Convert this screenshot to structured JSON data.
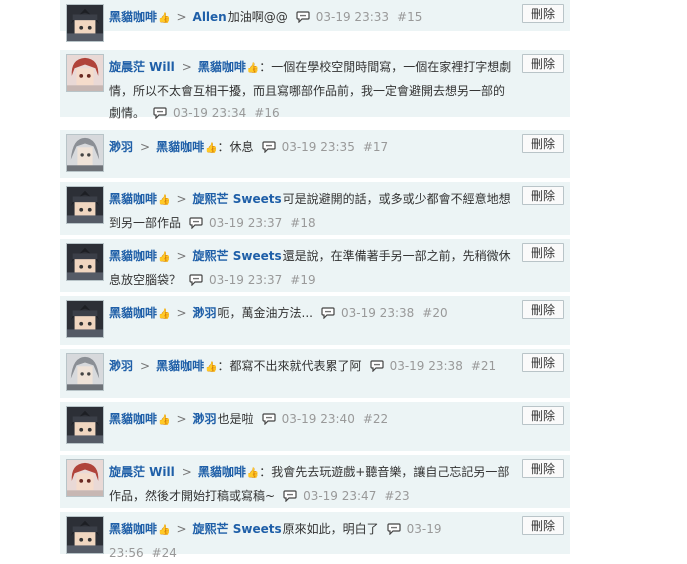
{
  "delete_label": "刪除",
  "comments": [
    {
      "from": "黑貓咖啡",
      "from_badge": "👍",
      "to": "Allen",
      "to_badge": "",
      "text": "加油啊@@",
      "time": "03-19 23:33",
      "floor": "#15",
      "avatar": "dark"
    },
    {
      "from": "旋晨茫 Will",
      "from_badge": "",
      "to": "黑貓咖啡",
      "to_badge": "👍",
      "text": "：一個在學校空閒時間寫，一個在家裡打字想劇情，所以不太會互相干擾，而且寫哪部作品前，我一定會避開去想另一部的劇情。",
      "time": "03-19 23:34",
      "floor": "#16",
      "avatar": "red"
    },
    {
      "from": "渺羽",
      "from_badge": "",
      "to": "黑貓咖啡",
      "to_badge": "👍",
      "text": "：休息",
      "time": "03-19 23:35",
      "floor": "#17",
      "avatar": "grey"
    },
    {
      "from": "黑貓咖啡",
      "from_badge": "👍",
      "to": "旋熙芒 Sweets",
      "to_badge": "",
      "text": "可是說避開的話，或多或少都會不經意地想到另一部作品",
      "time": "03-19 23:37",
      "floor": "#18",
      "avatar": "dark"
    },
    {
      "from": "黑貓咖啡",
      "from_badge": "👍",
      "to": "旋熙芒 Sweets",
      "to_badge": "",
      "text": "還是說，在準備著手另一部之前，先稍微休息放空腦袋？",
      "time": "03-19 23:37",
      "floor": "#19",
      "avatar": "dark"
    },
    {
      "from": "黑貓咖啡",
      "from_badge": "👍",
      "to": "渺羽",
      "to_badge": "",
      "text": "呃，萬金油方法...",
      "time": "03-19 23:38",
      "floor": "#20",
      "avatar": "dark"
    },
    {
      "from": "渺羽",
      "from_badge": "",
      "to": "黑貓咖啡",
      "to_badge": "👍",
      "text": "：都寫不出來就代表累了阿",
      "time": "03-19 23:38",
      "floor": "#21",
      "avatar": "grey"
    },
    {
      "from": "黑貓咖啡",
      "from_badge": "👍",
      "to": "渺羽",
      "to_badge": "",
      "text": "也是啦",
      "time": "03-19 23:40",
      "floor": "#22",
      "avatar": "dark"
    },
    {
      "from": "旋晨茫 Will",
      "from_badge": "",
      "to": "黑貓咖啡",
      "to_badge": "👍",
      "text": "：我會先去玩遊戲+聽音樂，讓自己忘記另一部作品，然後才開始打稿或寫稿~",
      "time": "03-19 23:47",
      "floor": "#23",
      "avatar": "red"
    },
    {
      "from": "黑貓咖啡",
      "from_badge": "👍",
      "to": "旋熙芒 Sweets",
      "to_badge": "",
      "text": "原來如此，明白了",
      "time": "03-19 23:56",
      "floor": "#24",
      "avatar": "dark"
    }
  ]
}
